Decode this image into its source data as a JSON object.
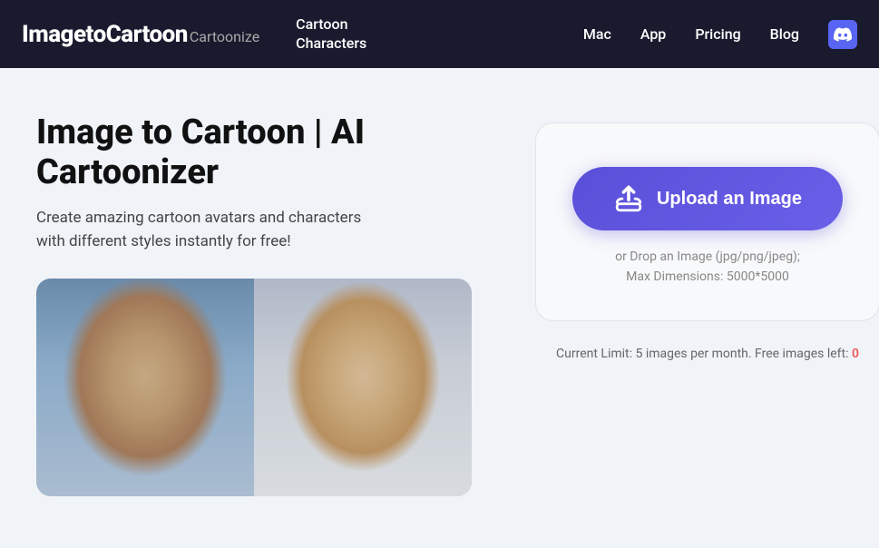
{
  "nav": {
    "brand_main": "ImagetoCartoon",
    "brand_sub": "Cartoonize",
    "cartoon_line1": "Cartoon",
    "cartoon_line2": "Characters",
    "links": [
      {
        "label": "Mac",
        "name": "nav-mac"
      },
      {
        "label": "App",
        "name": "nav-app"
      },
      {
        "label": "Pricing",
        "name": "nav-pricing"
      },
      {
        "label": "Blog",
        "name": "nav-blog"
      }
    ],
    "discord_label": "Discord"
  },
  "hero": {
    "title": "Image to Cartoon | AI Cartoonizer",
    "subtitle": "Create amazing cartoon avatars and characters\nwith different styles instantly for free!",
    "upload_button": "Upload an Image",
    "upload_hint_line1": "or Drop an Image (jpg/png/jpeg);",
    "upload_hint_line2": "Max Dimensions: 5000*5000",
    "limit_text": "Current Limit: 5 images per month. Free images left:",
    "limit_count": "0"
  }
}
